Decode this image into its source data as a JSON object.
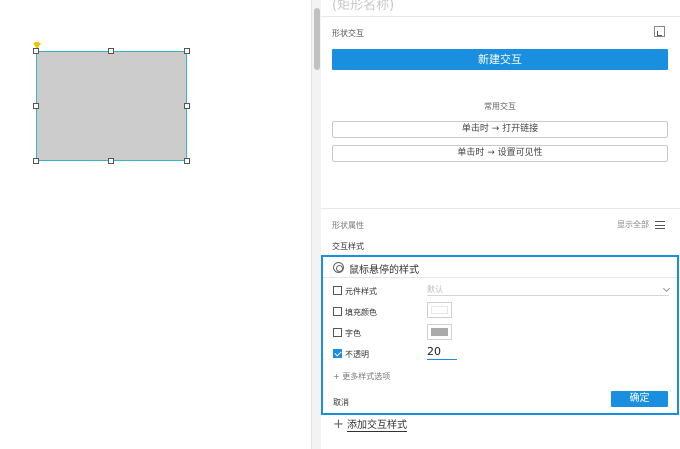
{
  "panel": {
    "header_title": "(矩形名称)",
    "shape_interaction_label": "形状交互",
    "new_interaction_label": "新建交互",
    "common_interactions_label": "常用交互",
    "common_actions": [
      "单击时 → 打开链接",
      "单击时 → 设置可见性"
    ],
    "shape_properties_label": "形状属性",
    "show_all_label": "显示全部",
    "interaction_styles_label": "交互样式"
  },
  "hover_style": {
    "title": "鼠标悬停的样式",
    "rows": [
      {
        "label": "元件样式",
        "checked": false,
        "value_placeholder": "默认"
      },
      {
        "label": "填充颜色",
        "checked": false,
        "swatch": "#ffffff"
      },
      {
        "label": "字色",
        "checked": false,
        "swatch": "#aaaaaa"
      },
      {
        "label": "不透明",
        "checked": true,
        "value": "20"
      }
    ],
    "more_options_label": "+ 更多样式选项",
    "cancel_label": "取消",
    "confirm_label": "确定"
  },
  "add_interaction_style_label": "添加交互样式",
  "colors": {
    "accent": "#1a8fe0",
    "shape_fill": "#cccccc",
    "selection_border": "#38b6c9"
  }
}
